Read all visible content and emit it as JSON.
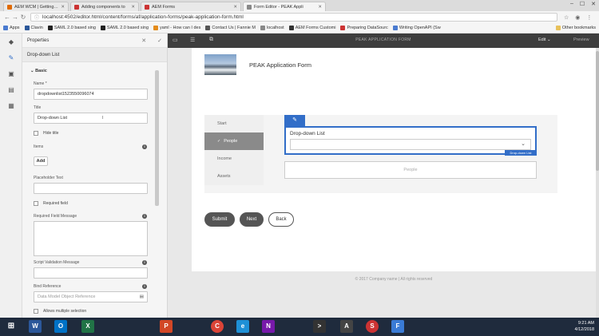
{
  "browser": {
    "tabs": [
      {
        "label": "AEM WCM | Getting Star",
        "color": "#e06a00"
      },
      {
        "label": "Adding components to",
        "color": "#c33"
      },
      {
        "label": "AEM Forms",
        "color": "#c33"
      },
      {
        "label": "Form Editor - PEAK Appli",
        "color": "#888"
      }
    ],
    "url": "localhost:4502/editor.html/content/forms/af/application-forms/peak-application-form.html",
    "bookmarks": [
      {
        "label": "Apps",
        "color": "#4a7bd0"
      },
      {
        "label": "Clavin",
        "color": "#2b579a"
      },
      {
        "label": "SAML 2.0 based sing",
        "color": "#222"
      },
      {
        "label": "SAML 2.0 based sing",
        "color": "#222"
      },
      {
        "label": "yaml - How can I des",
        "color": "#e48b1b"
      },
      {
        "label": "Contact Us | Fannie M",
        "color": "#555"
      },
      {
        "label": "localhost",
        "color": "#888"
      },
      {
        "label": "AEM Forms Customi",
        "color": "#333"
      },
      {
        "label": "Preparing DataSourc",
        "color": "#c33"
      },
      {
        "label": "Writing OpenAPI (Sw",
        "color": "#4a7bd0"
      }
    ],
    "other_bookmarks": "Other bookmarks"
  },
  "properties": {
    "title": "Properties",
    "component": "Drop-down List",
    "section": "Basic",
    "name_label": "Name *",
    "name_value": "dropdownlist1523550096074",
    "title_label": "Title",
    "title_value": "Drop-down List",
    "hide_title": "Hide title",
    "items_label": "Items",
    "add_label": "Add",
    "placeholder_label": "Placeholder Text",
    "required_field": "Required field",
    "required_msg_label": "Required Field Message",
    "script_msg_label": "Script Validation Message",
    "bind_ref_label": "Bind Reference",
    "bind_ref_placeholder": "Data Model Object Reference",
    "allow_multiple": "Allows multiple selection"
  },
  "topbar": {
    "center": "PEAK APPLICATION FORM",
    "edit": "Edit",
    "preview": "Preview"
  },
  "form": {
    "title": "PEAK Application Form",
    "nav": [
      "Start",
      "People",
      "Income",
      "Assets"
    ],
    "active_nav": "People",
    "dropdown_label": "Drop-down List",
    "dropdown_tag": "Drop-down List",
    "people_placeholder": "People",
    "buttons": {
      "submit": "Submit",
      "next": "Next",
      "back": "Back"
    },
    "footer": "© 2017 Company name | All rights reserved"
  },
  "taskbar": {
    "apps": [
      {
        "icon": "W",
        "color": "#2b579a"
      },
      {
        "icon": "O",
        "color": "#0072c6"
      },
      {
        "icon": "X",
        "color": "#217346"
      },
      {
        "icon": "P",
        "color": "#d24726"
      },
      {
        "icon": "C",
        "color": "#db4437"
      },
      {
        "icon": "e",
        "color": "#1e90d6"
      },
      {
        "icon": "N",
        "color": "#7719aa"
      },
      {
        "icon": ">",
        "color": "#333"
      },
      {
        "icon": "A",
        "color": "#444"
      },
      {
        "icon": "S",
        "color": "#c33"
      },
      {
        "icon": "F",
        "color": "#3a7bd5"
      }
    ],
    "time": "9:21 AM",
    "date": "4/12/2018"
  }
}
